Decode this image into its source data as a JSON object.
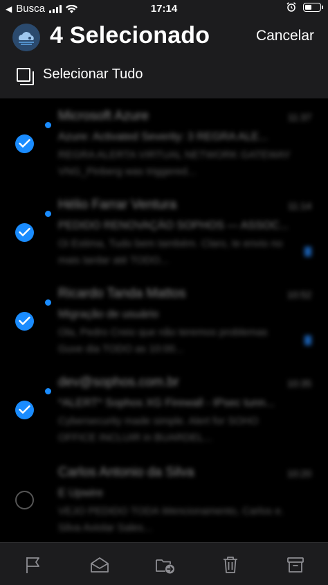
{
  "status_bar": {
    "carrier": "Busca",
    "time": "17:14"
  },
  "header": {
    "title": "4 Selecionado",
    "cancel_label": "Cancelar",
    "select_all_label": "Selecionar Tudo"
  },
  "messages": [
    {
      "sender": "Microsoft Azure",
      "date": "11:37",
      "subject": "Azure: Activated Severity: 3 REGRA ALE...",
      "preview": "REGRA ALERTA VIRTUAL NETWORK GATEWAY VNG_Pinberg was triggered...",
      "selected": true,
      "unread": true
    },
    {
      "sender": "Hélio Farrar Ventura",
      "date": "11:14",
      "subject": "PEDIDO RENOVAÇÃO SOPHOS — ASSOC...",
      "preview": "Oi Estima, Tudo bem também. Claro, te envio no mais tardar até TODO...",
      "selected": true,
      "unread": true
    },
    {
      "sender": "Ricardo Tanda Mattos",
      "date": "10:52",
      "subject": "Migração de usuário",
      "preview": "Ola, Pedro Creio que não teremos problemas Guve dia TODO as 10:00...",
      "selected": true,
      "unread": true
    },
    {
      "sender": "dev@sophos.com.br",
      "date": "10:35",
      "subject": "*ALERT* Sophos XG Firewall - IPsec tunn...",
      "preview": "Cybersecurity made simple. Alert for SOHO OFFICE INCLUIR in BUARDEL...",
      "selected": true,
      "unread": true
    },
    {
      "sender": "Carlos Antonio da Silva",
      "date": "10:20",
      "subject": "E Upwire",
      "preview": "VEJO PEDIDO TODA Wencionamento, Carlos e. Silva Aviolar Sales...",
      "selected": false,
      "unread": false
    }
  ],
  "toolbar": {
    "icons": [
      "flag-icon",
      "envelope-open-icon",
      "move-folder-icon",
      "trash-icon",
      "archive-icon"
    ]
  },
  "colors": {
    "accent": "#1a8cff",
    "header_bg": "#1c1c1e"
  }
}
